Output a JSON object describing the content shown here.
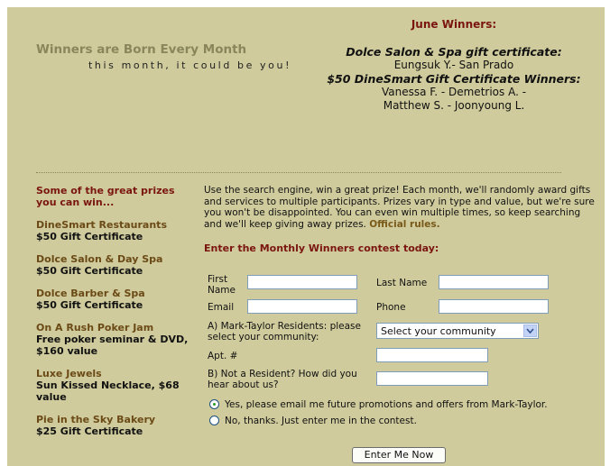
{
  "header": {
    "headline": "Winners are Born Every Month",
    "tagline": "this month, it could be you!"
  },
  "winners": {
    "title": "June Winners:",
    "dolce_heading": "Dolce Salon & Spa gift certificate:",
    "dolce_winner": "Eungsuk Y.- San Prado",
    "dinesmart_heading": "$50 DineSmart Gift Certificate Winners:",
    "dinesmart_line1": "Vanessa F. - Demetrios A. -",
    "dinesmart_line2": "Matthew S. - Joonyoung L."
  },
  "prizes": {
    "title": "Some of the great prizes you can win...",
    "items": [
      {
        "name": "DineSmart Restaurants",
        "desc": "$50 Gift Certificate"
      },
      {
        "name": "Dolce Salon & Day Spa",
        "desc": "$50 Gift Certificate"
      },
      {
        "name": "Dolce Barber & Spa",
        "desc": "$50 Gift Certificate"
      },
      {
        "name": "On A Rush Poker Jam",
        "desc": "Free poker seminar & DVD, $160 value"
      },
      {
        "name": "Luxe Jewels",
        "desc": "Sun Kissed Necklace, $68 value"
      },
      {
        "name": "Pie in the Sky Bakery",
        "desc": "$25 Gift Certificate"
      }
    ]
  },
  "intro": {
    "text": "Use the search engine, win a great prize! Each month, we'll randomly award gifts and services to multiple participants. Prizes vary in type and value, but we're sure you won't be disappointed. You can even win multiple times, so keep searching and we'll keep giving away prizes.",
    "rules_link": "Official rules."
  },
  "form": {
    "title": "Enter the Monthly Winners contest today:",
    "first_name_label": "First Name",
    "last_name_label": "Last Name",
    "email_label": "Email",
    "phone_label": "Phone",
    "resident_label": "A) Mark-Taylor Residents: please select your community:",
    "community_selected": "Select your community",
    "apt_label": "Apt. #",
    "nonresident_label": "B) Not a Resident? How did you hear about us?",
    "radio_yes": "Yes, please email me future promotions and offers from Mark-Taylor.",
    "radio_no": "No, thanks. Just enter me in the contest.",
    "submit": "Enter Me Now"
  }
}
